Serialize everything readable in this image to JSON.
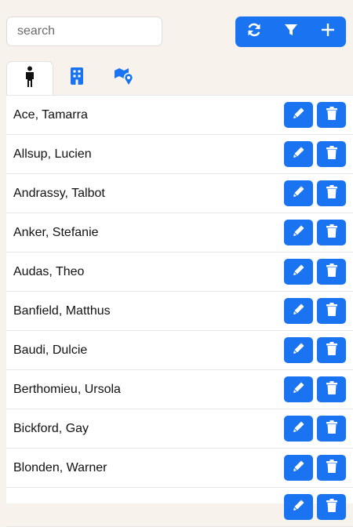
{
  "search": {
    "placeholder": "search",
    "value": ""
  },
  "toolbar": {
    "buttons": [
      {
        "icon": "refresh-icon"
      },
      {
        "icon": "filter-icon"
      },
      {
        "icon": "plus-icon"
      }
    ],
    "accent": "#1a73f0"
  },
  "tabs": [
    {
      "icon": "person-icon",
      "active": true
    },
    {
      "icon": "building-icon",
      "active": false
    },
    {
      "icon": "map-location-icon",
      "active": false
    }
  ],
  "people": [
    {
      "name": "Ace, Tamarra"
    },
    {
      "name": "Allsup, Lucien"
    },
    {
      "name": "Andrassy, Talbot"
    },
    {
      "name": "Anker, Stefanie"
    },
    {
      "name": "Audas, Theo"
    },
    {
      "name": "Banfield, Matthus"
    },
    {
      "name": "Baudi, Dulcie"
    },
    {
      "name": "Berthomieu, Ursola"
    },
    {
      "name": "Bickford, Gay"
    },
    {
      "name": "Blonden, Warner"
    },
    {
      "name": ""
    }
  ],
  "row_actions": {
    "edit_icon": "pencil-icon",
    "delete_icon": "trash-icon"
  }
}
